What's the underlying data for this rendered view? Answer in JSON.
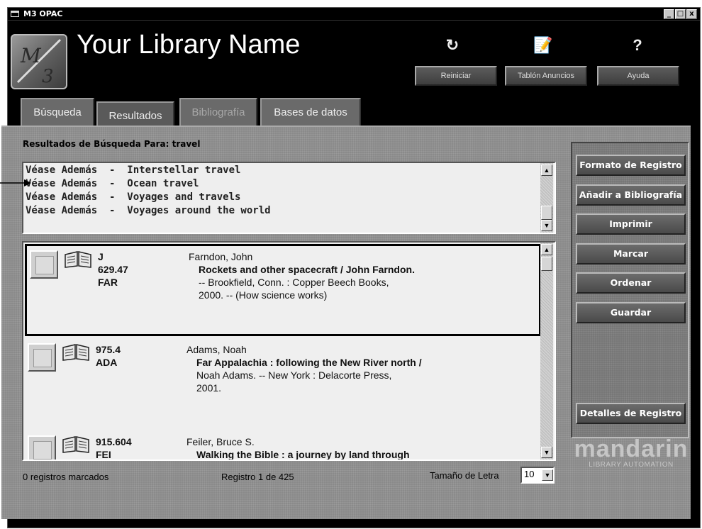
{
  "window": {
    "title": "M3 OPAC",
    "controls": [
      "_",
      "□",
      "x"
    ]
  },
  "header": {
    "library_name": "Your Library Name",
    "buttons": [
      {
        "label": "Reiniciar",
        "icon": "reset-icon"
      },
      {
        "label": "Tablón Anuncios",
        "icon": "notice-board-icon"
      },
      {
        "label": "Ayuda",
        "icon": "help-icon"
      }
    ]
  },
  "tabs": [
    {
      "label": "Búsqueda",
      "state": "enabled"
    },
    {
      "label": "Resultados",
      "state": "active"
    },
    {
      "label": "Bibliografía",
      "state": "disabled"
    },
    {
      "label": "Bases de datos",
      "state": "enabled"
    }
  ],
  "results": {
    "heading": "Resultados de Búsqueda Para: travel",
    "see_also": [
      "Véase Además  -  Interstellar travel",
      "Véase Además  -  Ocean travel",
      "Véase Además  -  Voyages and travels",
      "Véase Además  -  Voyages around the world"
    ],
    "records": [
      {
        "call_number": [
          "J",
          "629.47",
          "FAR"
        ],
        "author": "Farndon, John",
        "title": "Rockets and other spacecraft",
        "rest1": " / John Farndon.",
        "rest2": "-- Brookfield, Conn. : Copper Beech Books,",
        "rest3": "2000. -- (How science works)",
        "selected": true
      },
      {
        "call_number": [
          "975.4",
          "ADA"
        ],
        "author": "Adams, Noah",
        "title": "Far Appalachia : following the New River north",
        "rest1": " /",
        "rest2": "Noah Adams.  -- New York : Delacorte Press,",
        "rest3": "2001.",
        "selected": false
      },
      {
        "call_number": [
          "915.604",
          "FEI"
        ],
        "author": "Feiler, Bruce S.",
        "title": "Walking the Bible : a journey by land through",
        "rest1": "",
        "rest2": "",
        "rest3": "",
        "selected": false
      }
    ],
    "marked_count": "0 registros marcados",
    "position": "Registro 1 de 425",
    "font_size_label": "Tamaño de Letra",
    "font_size_value": "10"
  },
  "panel": {
    "buttons": [
      "Formato de Registro",
      "Añadir a Bibliografía",
      "Imprimir",
      "Marcar",
      "Ordenar",
      "Guardar",
      "Detalles de Registro"
    ],
    "brand_main": "mandarin",
    "brand_sub": "LIBRARY AUTOMATION"
  },
  "colors": {
    "window_bg": "#000000",
    "body_bg": "#8a8a8a",
    "list_bg": "#efefef",
    "button_bg": "#555555"
  }
}
